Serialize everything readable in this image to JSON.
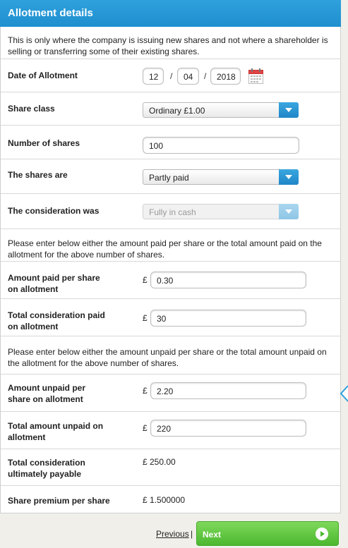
{
  "header": {
    "title": "Allotment details"
  },
  "intro_note": "This is only where the company is issuing new shares and not where a shareholder is selling or transferring some of their existing shares.",
  "date_of_allotment": {
    "label": "Date of Allotment",
    "day": "12",
    "month": "04",
    "year": "2018",
    "separator": "/",
    "calendar_icon": "calendar-icon"
  },
  "share_class": {
    "label": "Share class",
    "selected": "Ordinary £1.00"
  },
  "number_of_shares": {
    "label": "Number of shares",
    "value": "100"
  },
  "shares_are": {
    "label": "The shares are",
    "selected": "Partly paid"
  },
  "consideration": {
    "label": "The consideration was",
    "selected": "Fully in cash"
  },
  "paid_note": "Please enter below either the amount paid per share or the total amount paid on the allotment for the above number of shares.",
  "amount_paid_per_share": {
    "label_line1": "Amount paid per share",
    "label_line2": "on allotment",
    "currency": "£",
    "value": "0.30"
  },
  "total_consideration_paid": {
    "label_line1": "Total consideration paid",
    "label_line2": "on allotment",
    "currency": "£",
    "value": "30"
  },
  "unpaid_note": "Please enter below either the amount unpaid per share or the total amount unpaid on the allotment for the above number of shares.",
  "amount_unpaid_per_share": {
    "label_line1": "Amount unpaid per",
    "label_line2": "share on allotment",
    "currency": "£",
    "value": "2.20"
  },
  "total_amount_unpaid": {
    "label_line1": "Total amount unpaid on",
    "label_line2": "allotment",
    "currency": "£",
    "value": "220"
  },
  "total_consideration_payable": {
    "label_line1": "Total consideration",
    "label_line2": "ultimately payable",
    "value": "£ 250.00"
  },
  "share_premium": {
    "label": "Share premium per share",
    "value": "£ 1.500000"
  },
  "footer": {
    "previous_label": "Previous",
    "separator": "|",
    "next_label": "Next"
  },
  "colors": {
    "header": "#2fa1dc",
    "select_button": "#1f86c7",
    "next_button": "#4bb82f"
  }
}
